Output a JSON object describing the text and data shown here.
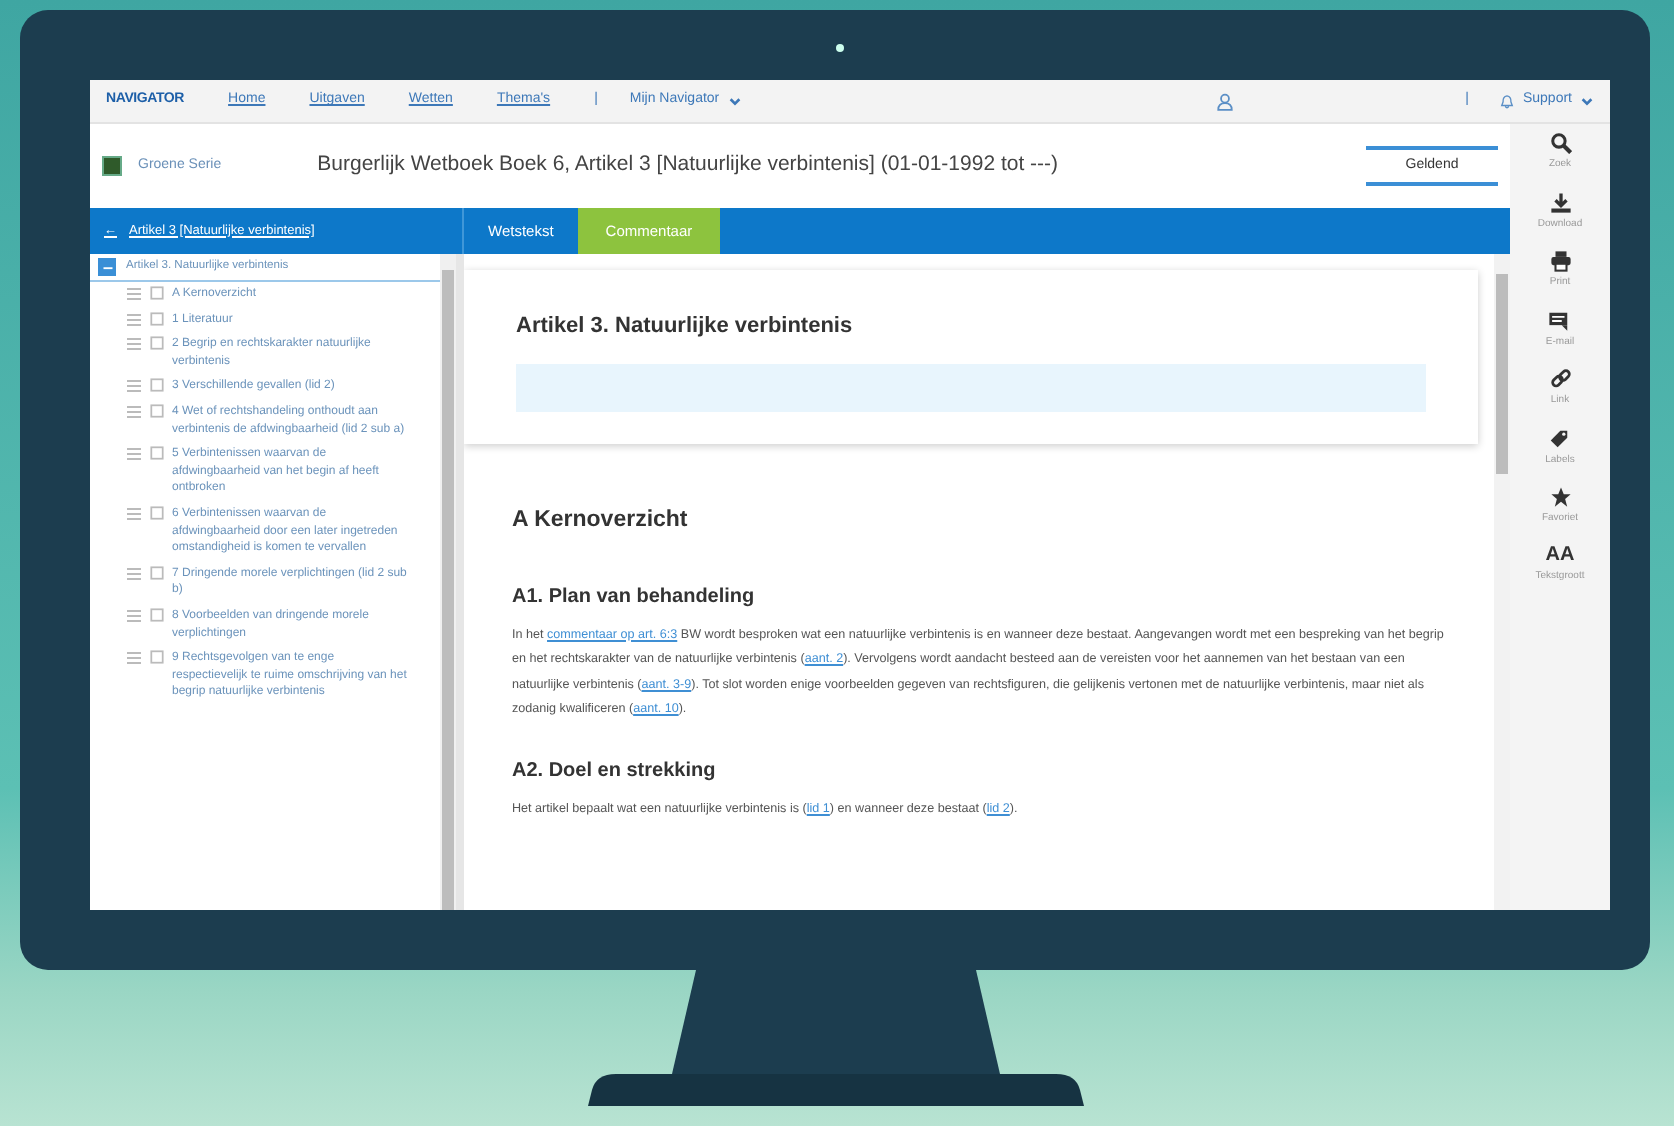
{
  "nav": {
    "logo": "NAVIGATOR",
    "items": [
      {
        "label": "Home"
      },
      {
        "label": "Uitgaven"
      },
      {
        "label": "Wetten"
      },
      {
        "label": "Thema's"
      }
    ],
    "separator": "|",
    "menu": "Mijn Navigator",
    "right_separator": "|",
    "support": "Support"
  },
  "header": {
    "publication": "Groene Serie",
    "title": "Burgerlijk Wetboek Boek 6, Artikel 3 [Natuurlijke verbintenis] (01-01-1992 tot ---)",
    "status_button": "Geldend"
  },
  "sidebar": {
    "back_arrow": "←",
    "back_label": "Artikel 3 [Natuurlijke verbintenis]",
    "tree": [
      {
        "label": "Artikel 3. Natuurlijke verbintenis",
        "expanded": true,
        "children": [
          {
            "label": "A Kernoverzicht"
          },
          {
            "label": "1 Literatuur"
          },
          {
            "label": "2 Begrip en rechtskarakter natuurlijke verbintenis"
          },
          {
            "label": "3 Verschillende gevallen (lid 2)"
          },
          {
            "label": "4 Wet of rechtshandeling onthoudt aan verbintenis de afdwingbaarheid (lid 2 sub a)"
          },
          {
            "label": "5 Verbintenissen waarvan de afdwingbaarheid van het begin af heeft ontbroken"
          },
          {
            "label": "6 Verbintenissen waarvan de afdwingbaarheid door een later ingetreden omstandigheid is komen te vervallen"
          },
          {
            "label": "7 Dringende morele verplichtingen (lid 2 sub b)"
          },
          {
            "label": "8 Voorbeelden van dringende morele verplichtingen"
          },
          {
            "label": "9 Rechtsgevolgen van te enge respectievelijk te ruime omschrijving van het begrip natuurlijke verbintenis"
          }
        ]
      }
    ]
  },
  "tabs": [
    {
      "label": "Wetstekst",
      "selected": false
    },
    {
      "label": "Commentaar",
      "selected": true
    }
  ],
  "document": {
    "title": "Artikel 3. Natuurlijke verbintenis",
    "heading": "A Kernoverzicht",
    "sections": [
      {
        "heading": "A1. Plan van behandeling",
        "paragraph": [
          {
            "kind": "text",
            "text": "In het "
          },
          {
            "kind": "link",
            "text": "commentaar op art. 6:3"
          },
          {
            "kind": "text",
            "text": " BW wordt besproken wat een natuurlijke verbintenis is en wanneer deze bestaat. Aangevangen wordt met een bespreking van het begrip en het rechtskarakter van de natuurlijke verbintenis ("
          },
          {
            "kind": "link",
            "text": "aant. 2"
          },
          {
            "kind": "text",
            "text": "). Vervolgens wordt aandacht besteed aan de vereisten voor het aannemen van het bestaan van een natuurlijke verbintenis ("
          },
          {
            "kind": "link",
            "text": "aant. 3-9"
          },
          {
            "kind": "text",
            "text": "). Tot slot worden enige voorbeelden gegeven van rechtsfiguren, die gelijkenis vertonen met de natuurlijke verbintenis, maar niet als zodanig kwalificeren ("
          },
          {
            "kind": "link",
            "text": "aant. 10"
          },
          {
            "kind": "text",
            "text": ")."
          }
        ]
      },
      {
        "heading": "A2. Doel en strekking",
        "paragraph": [
          {
            "kind": "text",
            "text": "Het artikel bepaalt wat een natuurlijke verbintenis is ("
          },
          {
            "kind": "link",
            "text": "lid 1"
          },
          {
            "kind": "text",
            "text": ") en wanneer deze bestaat ("
          },
          {
            "kind": "link",
            "text": "lid 2"
          },
          {
            "kind": "text",
            "text": ")."
          }
        ]
      }
    ]
  },
  "toolbar": [
    {
      "kind": "search",
      "label": "Zoek"
    },
    {
      "kind": "download",
      "label": "Download"
    },
    {
      "kind": "print",
      "label": "Print"
    },
    {
      "kind": "email",
      "label": "E-mail"
    },
    {
      "kind": "link",
      "label": "Link"
    },
    {
      "kind": "label",
      "label": "Labels"
    },
    {
      "kind": "star",
      "label": "Favoriet"
    },
    {
      "kind": "textsize",
      "glyph": "AA",
      "label": "Tekstgroott"
    }
  ]
}
